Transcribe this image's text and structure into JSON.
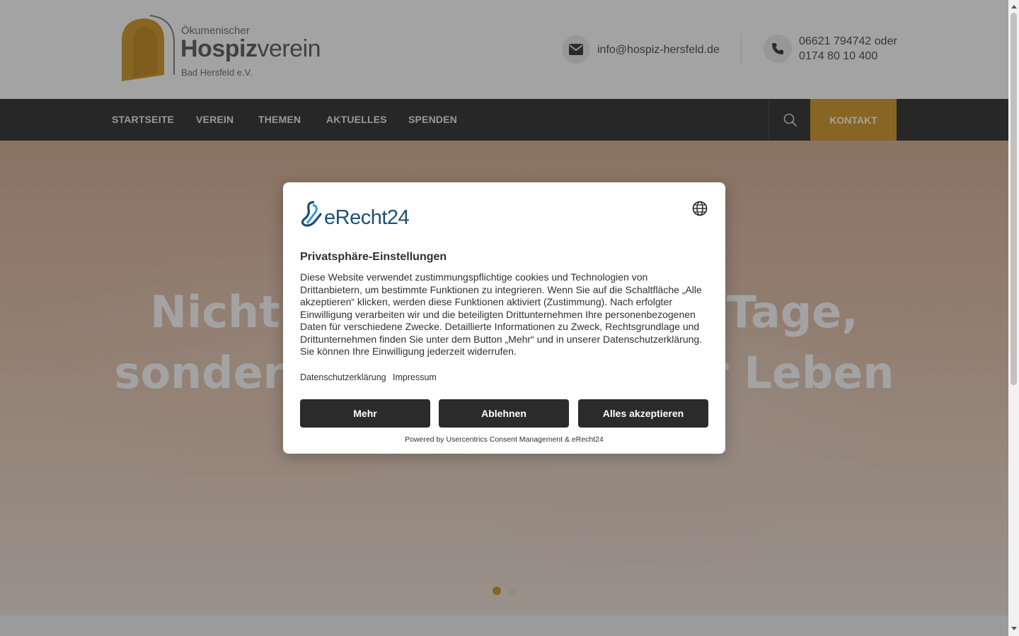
{
  "header": {
    "logo_line1": "Ökumenischer",
    "logo_bold": "Hospiz",
    "logo_light": "verein",
    "logo_line3": "Bad Hersfeld e.V.",
    "email": "info@hospiz-hersfeld.de",
    "phone_line1": "06621 794742 oder",
    "phone_line2": "0174 80 10 400",
    "email_icon": "envelope-icon",
    "phone_icon": "phone-icon"
  },
  "nav": {
    "items": [
      "STARTSEITE",
      "VEREIN",
      "THEMEN",
      "AKTUELLES",
      "SPENDEN"
    ],
    "search_icon": "search-icon",
    "cta": "KONTAKT"
  },
  "hero": {
    "line1": "Nicht dem Leben mehr Tage,",
    "line2": "sondern den Tagen mehr Leben",
    "visible_line1_left": "Nich",
    "visible_line1_right": "Tage,",
    "visible_line2_left": "so",
    "visible_line2_right": "ehr",
    "slides": 2,
    "active_slide": 1
  },
  "consent": {
    "logo_text": "eRecht24",
    "language_icon": "globe-icon",
    "title": "Privatsphäre-Einstellungen",
    "body": "Diese Website verwendet zustimmungspflichtige cookies und Technologien von Drittanbietern, um bestimmte Funktionen zu integrieren. Wenn Sie auf die Schaltfläche „Alle akzeptieren“ klicken, werden diese Funktionen aktiviert (Zustimmung). Nach erfolgter Einwilligung verarbeiten wir und die beteiligten Drittunternehmen Ihre personenbezogenen Daten für verschiedene Zwecke. Detaillierte Informationen zu Zweck, Rechtsgrundlage und Drittunternehmen finden Sie unter dem Button „Mehr“ und in unserer Datenschutzerklärung. Sie können Ihre Einwilligung jederzeit widerrufen.",
    "link_privacy": "Datenschutzerklärung",
    "link_imprint": "Impressum",
    "btn_more": "Mehr",
    "btn_decline": "Ablehnen",
    "btn_accept": "Alles akzeptieren",
    "powered": "Powered by Usercentrics Consent Management & eRecht24"
  },
  "colors": {
    "accent": "#d39e36",
    "nav_bg": "#3d3d3d",
    "modal_button": "#2b2b2b",
    "brand_blue": "#1d4f73"
  }
}
